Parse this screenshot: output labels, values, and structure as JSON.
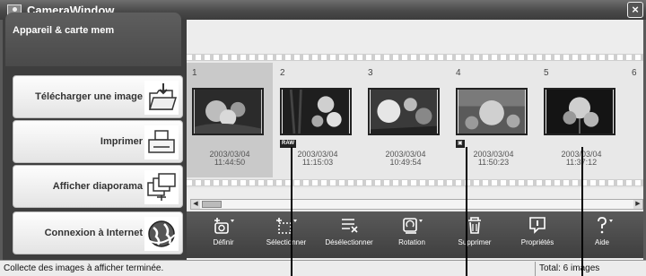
{
  "window": {
    "title": "CameraWindow",
    "close_glyph": "×"
  },
  "sidebar": {
    "header": "Appareil & carte mem",
    "items": [
      {
        "label": "Télécharger une image",
        "icon": "download-folder-icon"
      },
      {
        "label": "Imprimer",
        "icon": "print-icon"
      },
      {
        "label": "Afficher diaporama",
        "icon": "slideshow-icon"
      },
      {
        "label": "Connexion à Internet",
        "icon": "internet-globe-icon"
      }
    ]
  },
  "images": [
    {
      "number": "1",
      "date": "2003/03/04",
      "time": "11:44:50",
      "badge": "",
      "selected": true
    },
    {
      "number": "2",
      "date": "2003/03/04",
      "time": "11:15:03",
      "badge": "RAW",
      "selected": false
    },
    {
      "number": "3",
      "date": "2003/03/04",
      "time": "10:49:54",
      "badge": "",
      "selected": false
    },
    {
      "number": "4",
      "date": "2003/03/04",
      "time": "11:50:23",
      "badge": "protect-icon",
      "selected": false
    },
    {
      "number": "5",
      "date": "2003/03/04",
      "time": "11:37:12",
      "badge": "",
      "selected": false
    },
    {
      "number": "6",
      "date": "",
      "time": "",
      "badge": "",
      "selected": false
    }
  ],
  "toolbar": {
    "items": [
      {
        "label": "Définir",
        "icon": "set-camera-icon"
      },
      {
        "label": "Sélectionner",
        "icon": "select-icon"
      },
      {
        "label": "Désélectionner",
        "icon": "deselect-icon"
      },
      {
        "label": "Rotation",
        "icon": "rotate-icon"
      },
      {
        "label": "Supprimer",
        "icon": "delete-icon"
      },
      {
        "label": "Propriétés",
        "icon": "properties-icon"
      },
      {
        "label": "Aide",
        "icon": "help-icon"
      }
    ]
  },
  "status": {
    "message": "Collecte des images à afficher terminée.",
    "total": "Total: 6 images"
  }
}
